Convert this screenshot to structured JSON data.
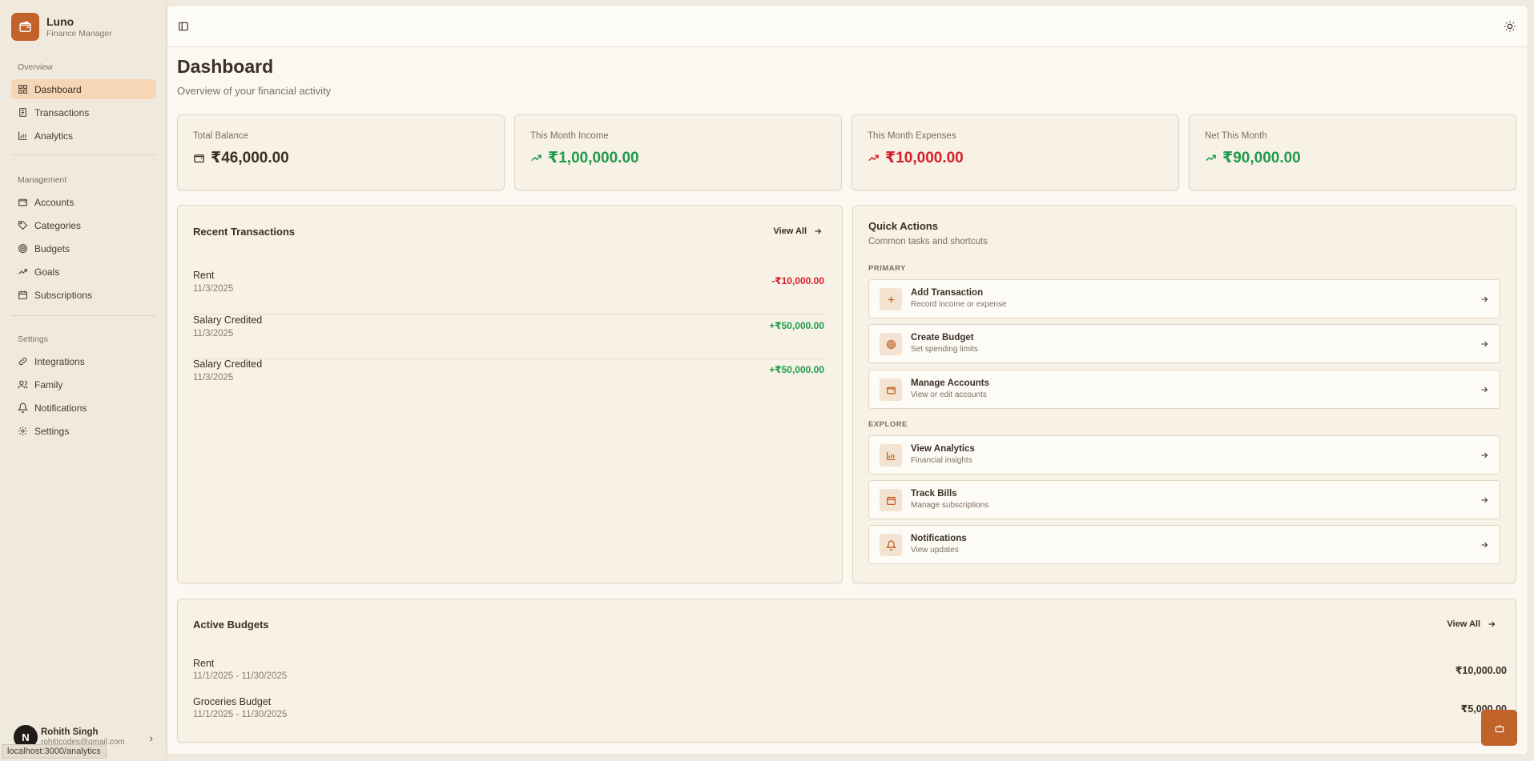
{
  "app": {
    "name": "Luno",
    "subtitle": "Finance Manager"
  },
  "sidebar": {
    "sections": [
      {
        "heading": "Overview",
        "items": [
          {
            "label": "Dashboard",
            "icon": "layout-grid-icon",
            "active": true
          },
          {
            "label": "Transactions",
            "icon": "receipt-icon"
          },
          {
            "label": "Analytics",
            "icon": "bar-chart-icon"
          }
        ]
      },
      {
        "heading": "Management",
        "items": [
          {
            "label": "Accounts",
            "icon": "wallet-icon"
          },
          {
            "label": "Categories",
            "icon": "tag-icon"
          },
          {
            "label": "Budgets",
            "icon": "target-icon"
          },
          {
            "label": "Goals",
            "icon": "trending-up-icon"
          },
          {
            "label": "Subscriptions",
            "icon": "calendar-icon"
          }
        ]
      },
      {
        "heading": "Settings",
        "items": [
          {
            "label": "Integrations",
            "icon": "link-icon"
          },
          {
            "label": "Family",
            "icon": "users-icon"
          },
          {
            "label": "Notifications",
            "icon": "bell-icon"
          },
          {
            "label": "Settings",
            "icon": "gear-icon"
          }
        ]
      }
    ]
  },
  "user": {
    "initial": "N",
    "name": "Rohith Singh",
    "email": "rohittcodes@gmail.com"
  },
  "status_bar": {
    "url": "localhost:3000/analytics"
  },
  "page": {
    "title": "Dashboard",
    "subtitle": "Overview of your financial activity"
  },
  "stats": [
    {
      "label": "Total Balance",
      "value": "₹46,000.00",
      "icon": "wallet-icon",
      "tone": "neutral"
    },
    {
      "label": "This Month Income",
      "value": "₹1,00,000.00",
      "icon": "trending-up-icon",
      "tone": "positive"
    },
    {
      "label": "This Month Expenses",
      "value": "₹10,000.00",
      "icon": "trending-up-icon",
      "tone": "negative"
    },
    {
      "label": "Net This Month",
      "value": "₹90,000.00",
      "icon": "trending-up-icon",
      "tone": "positive"
    }
  ],
  "recent": {
    "title": "Recent Transactions",
    "view_all": "View All",
    "items": [
      {
        "name": "Rent",
        "date": "11/3/2025",
        "amount": "-₹10,000.00",
        "tone": "negative"
      },
      {
        "name": "Salary Credited",
        "date": "11/3/2025",
        "amount": "+₹50,000.00",
        "tone": "positive"
      },
      {
        "name": "Salary Credited",
        "date": "11/3/2025",
        "amount": "+₹50,000.00",
        "tone": "positive"
      }
    ]
  },
  "quick_actions": {
    "title": "Quick Actions",
    "subtitle": "Common tasks and shortcuts",
    "groups": [
      {
        "label": "PRIMARY",
        "items": [
          {
            "label": "Add Transaction",
            "desc": "Record income or expense",
            "icon": "plus-icon"
          },
          {
            "label": "Create Budget",
            "desc": "Set spending limits",
            "icon": "target-icon"
          },
          {
            "label": "Manage Accounts",
            "desc": "View or edit accounts",
            "icon": "wallet-icon"
          }
        ]
      },
      {
        "label": "EXPLORE",
        "items": [
          {
            "label": "View Analytics",
            "desc": "Financial insights",
            "icon": "bar-chart-icon"
          },
          {
            "label": "Track Bills",
            "desc": "Manage subscriptions",
            "icon": "calendar-icon"
          },
          {
            "label": "Notifications",
            "desc": "View updates",
            "icon": "bell-icon"
          }
        ]
      }
    ]
  },
  "budgets": {
    "title": "Active Budgets",
    "view_all": "View All",
    "items": [
      {
        "name": "Rent",
        "range": "11/1/2025 - 11/30/2025",
        "amount": "₹10,000.00"
      },
      {
        "name": "Groceries Budget",
        "range": "11/1/2025 - 11/30/2025",
        "amount": "₹5,000.00"
      }
    ]
  },
  "colors": {
    "accent": "#c0622a",
    "active_nav": "#f5d6b6",
    "positive": "#1f9a4a",
    "negative": "#d2202a",
    "background": "#fbf8f2"
  }
}
